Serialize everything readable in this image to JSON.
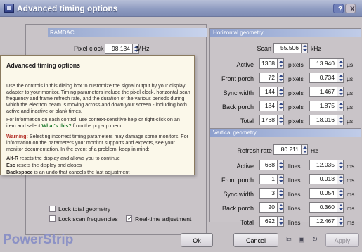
{
  "window": {
    "title": "Advanced timing options",
    "help_icon": "?",
    "close_icon": "X"
  },
  "ramdac": {
    "title": "RAMDAC",
    "pixel_clock_label": "Pixel clock",
    "pixel_clock_value": "98.134",
    "pixel_clock_unit": "MHz"
  },
  "help_popup": {
    "title": "Advanced timing options",
    "p1": "Use the controls in this dialog box to customize the signal output by your display adapter to your monitor. Timing parameters include the pixel clock, horizontal scan frequency and frame refresh rate, and the duration of the various periods during which the electron beam is moving across and down your screen - including both active and inactive or blank times.",
    "p2_a": "For information on each control, use context-sensitive help or right-click on an item and select ",
    "p2_link": "What's this?",
    "p2_b": " from the pop-up menu.",
    "p3_warning": "Warning:",
    "p3_text": " Selecting incorrect timing parameters may damage some monitors. For information on the parameters your monitor supports and expects, see your monitor documentation. In the event of a problem, keep in mind:",
    "k1_key": "Alt-R",
    "k1_text": " resets the display and allows you to continue",
    "k2_key": "Esc",
    "k2_text": " resets the display and closes",
    "k3_key": "Backspace",
    "k3_text": " is an undo that cancels the last adjustment"
  },
  "horizontal": {
    "title": "Horizontal geometry",
    "scan_rate_label": "Scan rate",
    "scan_rate_value": "55.506",
    "scan_rate_unit": "kHz",
    "rows": [
      {
        "label": "Active",
        "pixels": "1368",
        "pixels_unit": "pixels",
        "time": "13.940",
        "time_unit": "µs"
      },
      {
        "label": "Front porch",
        "pixels": "72",
        "pixels_unit": "pixels",
        "time": "0.734",
        "time_unit": "µs"
      },
      {
        "label": "Sync width",
        "pixels": "144",
        "pixels_unit": "pixels",
        "time": "1.467",
        "time_unit": "µs"
      },
      {
        "label": "Back porch",
        "pixels": "184",
        "pixels_unit": "pixels",
        "time": "1.875",
        "time_unit": "µs"
      },
      {
        "label": "Total",
        "pixels": "1768",
        "pixels_unit": "pixels",
        "time": "18.016",
        "time_unit": "µs"
      }
    ]
  },
  "vertical": {
    "title": "Vertical geometry",
    "refresh_label": "Refresh rate",
    "refresh_value": "80.211",
    "refresh_unit": "Hz",
    "rows": [
      {
        "label": "Active",
        "lines": "668",
        "lines_unit": "lines",
        "time": "12.035",
        "time_unit": "ms"
      },
      {
        "label": "Front porch",
        "lines": "1",
        "lines_unit": "lines",
        "time": "0.018",
        "time_unit": "ms"
      },
      {
        "label": "Sync width",
        "lines": "3",
        "lines_unit": "lines",
        "time": "0.054",
        "time_unit": "ms"
      },
      {
        "label": "Back porch",
        "lines": "20",
        "lines_unit": "lines",
        "time": "0.360",
        "time_unit": "ms"
      },
      {
        "label": "Total",
        "lines": "692",
        "lines_unit": "lines",
        "time": "12.467",
        "time_unit": "ms"
      }
    ]
  },
  "options": {
    "lock_total_geometry": "Lock total geometry",
    "lock_scan_frequencies": "Lock scan frequencies",
    "realtime_adjustment": "Real-time adjustment",
    "realtime_checked": true,
    "lock_scan_checked": false,
    "lock_total_checked": false
  },
  "footer": {
    "brand": "PowerStrip",
    "ok_label": "Ok",
    "cancel_label": "Cancel",
    "apply_label": "Apply"
  }
}
